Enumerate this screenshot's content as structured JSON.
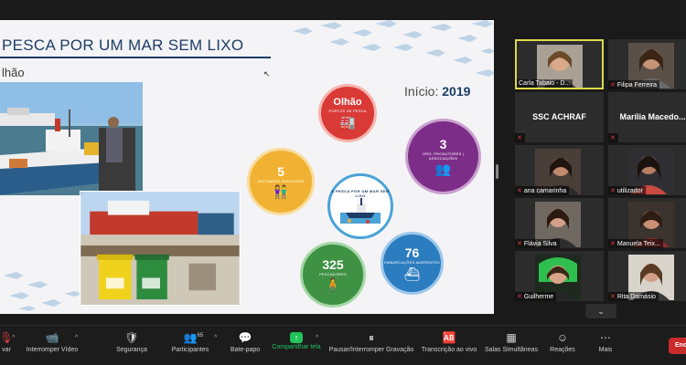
{
  "slide": {
    "title": "PESCA POR UM MAR SEM LIXO",
    "subtitle": "lhão",
    "year_label": "Início:",
    "year_value": "2019",
    "circles": {
      "olhao": {
        "number": "Olhão",
        "label": "PORTOS DE PESCA"
      },
      "orgs": {
        "number": "3",
        "label": "ORG. PRODUTORES | ASSOCIAÇÕES"
      },
      "entidades": {
        "number": "5",
        "label": "ENTIDADES PARCEIRAS"
      },
      "center": {
        "ring_text": "A PESCA POR UM MAR SEM LIXO"
      },
      "pescadores": {
        "number": "325",
        "label": "PESCADORES"
      },
      "embarcacoes": {
        "number": "76",
        "label": "EMBARCAÇÕES ADERENTES"
      }
    },
    "colors": {
      "olhao": "#d93a36",
      "orgs": "#7c2d87",
      "entidades": "#f1b233",
      "pescadores": "#3f9144",
      "embarcacoes": "#2c7cc0",
      "title": "#1d3d66"
    }
  },
  "gallery": {
    "participants": [
      {
        "name": "Carla Tabaio - D...",
        "active": true,
        "mic_muted": false
      },
      {
        "name": "Filipa Ferreira",
        "mic_muted": true
      },
      {
        "display_name": "SSC ACHRAF",
        "mic_muted": true
      },
      {
        "display_name": "Marília Macedo...",
        "mic_muted": true
      },
      {
        "name": "ana camarinha",
        "mic_muted": true
      },
      {
        "name": "utilizador",
        "mic_muted": true
      },
      {
        "name": "Flávia Silva",
        "mic_muted": true
      },
      {
        "name": "Manuela Teix...",
        "mic_muted": true
      },
      {
        "name": "Guilherme",
        "mic_muted": true
      },
      {
        "name": "Rita Damásio",
        "mic_muted": true
      }
    ],
    "more_icon": "chevron-down-icon"
  },
  "toolbar": {
    "audio_label": "var",
    "video_label": "Interromper Vídeo",
    "security_label": "Segurança",
    "participants_label": "Participantes",
    "participants_count": "65",
    "chat_label": "Bate-papo",
    "share_label": "Compartilhar tela",
    "record_label": "Pausar/Interromper Gravação",
    "transcript_label": "Transcrição ao vivo",
    "breakout_label": "Salas Simultâneas",
    "reactions_label": "Reações",
    "more_label": "Mais",
    "end_label": "Ence",
    "share_color": "#21c45a",
    "end_color": "#c92b2b"
  }
}
